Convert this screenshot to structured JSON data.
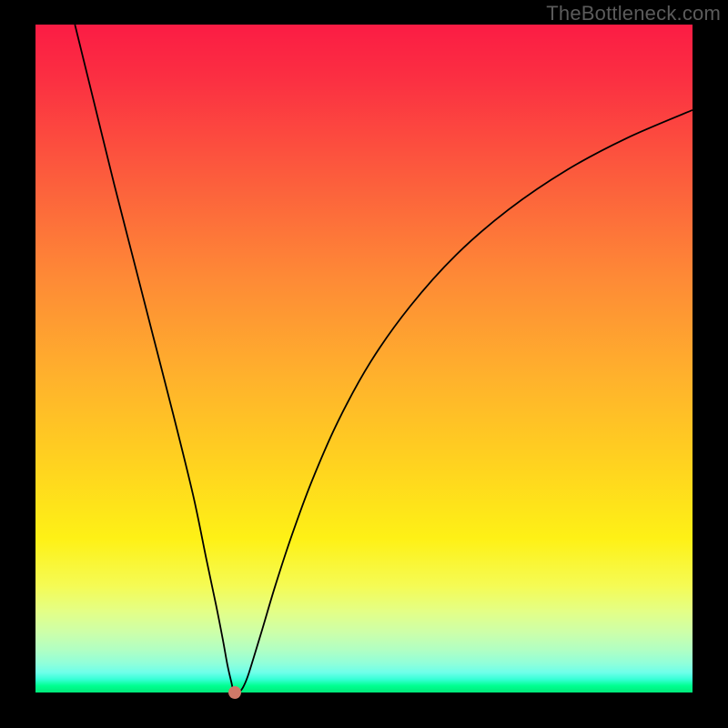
{
  "watermark": "TheBottleneck.com",
  "chart_data": {
    "type": "line",
    "title": "",
    "xlabel": "",
    "ylabel": "",
    "xlim": [
      0,
      100
    ],
    "ylim": [
      0,
      100
    ],
    "series": [
      {
        "name": "bottleneck-curve",
        "x": [
          6,
          9,
          12,
          15,
          18,
          21,
          24,
          26,
          27.5,
          28.5,
          29.2,
          29.8,
          30.2,
          31,
          31.6,
          32.3,
          33.2,
          34.5,
          36.5,
          39,
          42,
          46,
          51,
          57,
          64,
          72,
          81,
          90,
          100
        ],
        "y": [
          100,
          88,
          76,
          64.5,
          53,
          41.5,
          29.5,
          20,
          13,
          8,
          4.2,
          1.6,
          0.2,
          0.1,
          0.8,
          2.4,
          5.2,
          9.4,
          16,
          23.5,
          31.5,
          40.5,
          49.5,
          57.8,
          65.5,
          72.3,
          78.3,
          83,
          87.2
        ]
      }
    ],
    "annotations": [
      {
        "name": "min-point",
        "x": 30.4,
        "y": 0.0
      }
    ]
  },
  "colors": {
    "gradient_top": "#fb1c44",
    "gradient_bottom": "#00e97a",
    "curve": "#000000",
    "frame": "#000000",
    "watermark": "#5b5b5b",
    "min_point": "#cf7868"
  }
}
